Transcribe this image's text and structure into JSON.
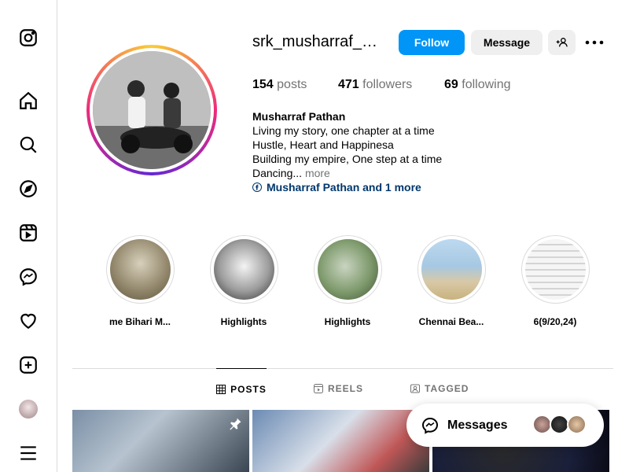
{
  "sidebar": {
    "items": [
      {
        "name": "instagram-logo-icon"
      },
      {
        "name": "home-icon"
      },
      {
        "name": "search-icon"
      },
      {
        "name": "explore-icon"
      },
      {
        "name": "reels-icon"
      },
      {
        "name": "messenger-icon"
      },
      {
        "name": "notifications-heart-icon"
      },
      {
        "name": "create-plus-icon"
      },
      {
        "name": "profile-avatar"
      },
      {
        "name": "menu-hamburger-icon"
      }
    ]
  },
  "profile": {
    "username": "srk_musharraf_pathan",
    "follow_label": "Follow",
    "message_label": "Message",
    "stats": {
      "posts_count": "154",
      "posts_label": "posts",
      "followers_count": "471",
      "followers_label": "followers",
      "following_count": "69",
      "following_label": "following"
    },
    "bio": {
      "name": "Musharraf Pathan",
      "line1": "Living my story, one chapter at a time ",
      "line2": "Hustle, Heart and Happinesa ",
      "line3": "Building my empire, One step at a time",
      "line4": "Dancing...",
      "more": "more",
      "link_text": "Musharraf Pathan and 1 more"
    }
  },
  "highlights": [
    {
      "label": "me Bihari M...",
      "color": "#9a8f76"
    },
    {
      "label": "Highlights",
      "color": "#8a8a8a"
    },
    {
      "label": "Highlights",
      "color": "#6f8a63"
    },
    {
      "label": "Chennai Bea...",
      "color": "#8fb4d6"
    },
    {
      "label": "6(9/20,24)",
      "color": "#d8d8d8"
    }
  ],
  "tabs": [
    {
      "label": "POSTS",
      "active": true
    },
    {
      "label": "REELS",
      "active": false
    },
    {
      "label": "TAGGED",
      "active": false
    }
  ],
  "messages": {
    "label": "Messages"
  },
  "colors": {
    "accent": "#0095f6",
    "link": "#00376b",
    "muted": "#737373"
  }
}
